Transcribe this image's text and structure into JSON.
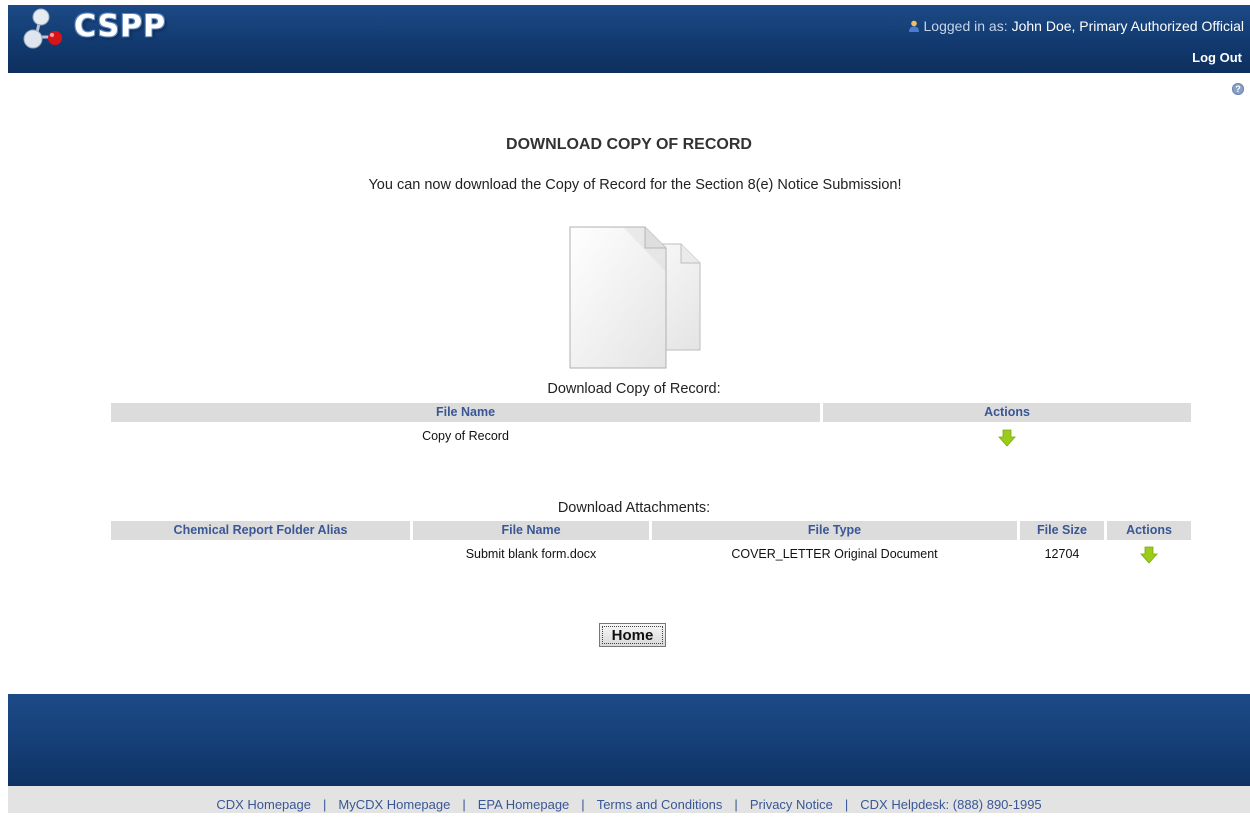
{
  "header": {
    "logo_text": "CSPP",
    "logged_in_label": "Logged in as:",
    "user_name": "John Doe, Primary Authorized Official",
    "logout_label": "Log Out"
  },
  "page": {
    "title": "DOWNLOAD COPY OF RECORD",
    "intro": "You can now download the Copy of Record for the Section 8(e) Notice Submission!"
  },
  "copy_of_record": {
    "caption": "Download Copy of Record:",
    "headers": [
      "File Name",
      "Actions"
    ],
    "rows": [
      {
        "file_name": "Copy of Record"
      }
    ]
  },
  "attachments": {
    "caption": "Download Attachments:",
    "headers": [
      "Chemical Report Folder Alias",
      "File Name",
      "File Type",
      "File Size",
      "Actions"
    ],
    "rows": [
      {
        "alias": "",
        "file_name": "Submit blank form.docx",
        "file_type": "COVER_LETTER Original Document",
        "file_size": "12704"
      }
    ]
  },
  "buttons": {
    "home_label": "Home"
  },
  "footer": {
    "links": [
      "CDX Homepage",
      "MyCDX Homepage",
      "EPA Homepage",
      "Terms and Conditions",
      "Privacy Notice",
      "CDX Helpdesk: (888) 890-1995"
    ],
    "separator": "|"
  },
  "colors": {
    "header_blue": "#123a70",
    "link_blue": "#3a5795",
    "arrow_green": "#9ccc1a"
  }
}
